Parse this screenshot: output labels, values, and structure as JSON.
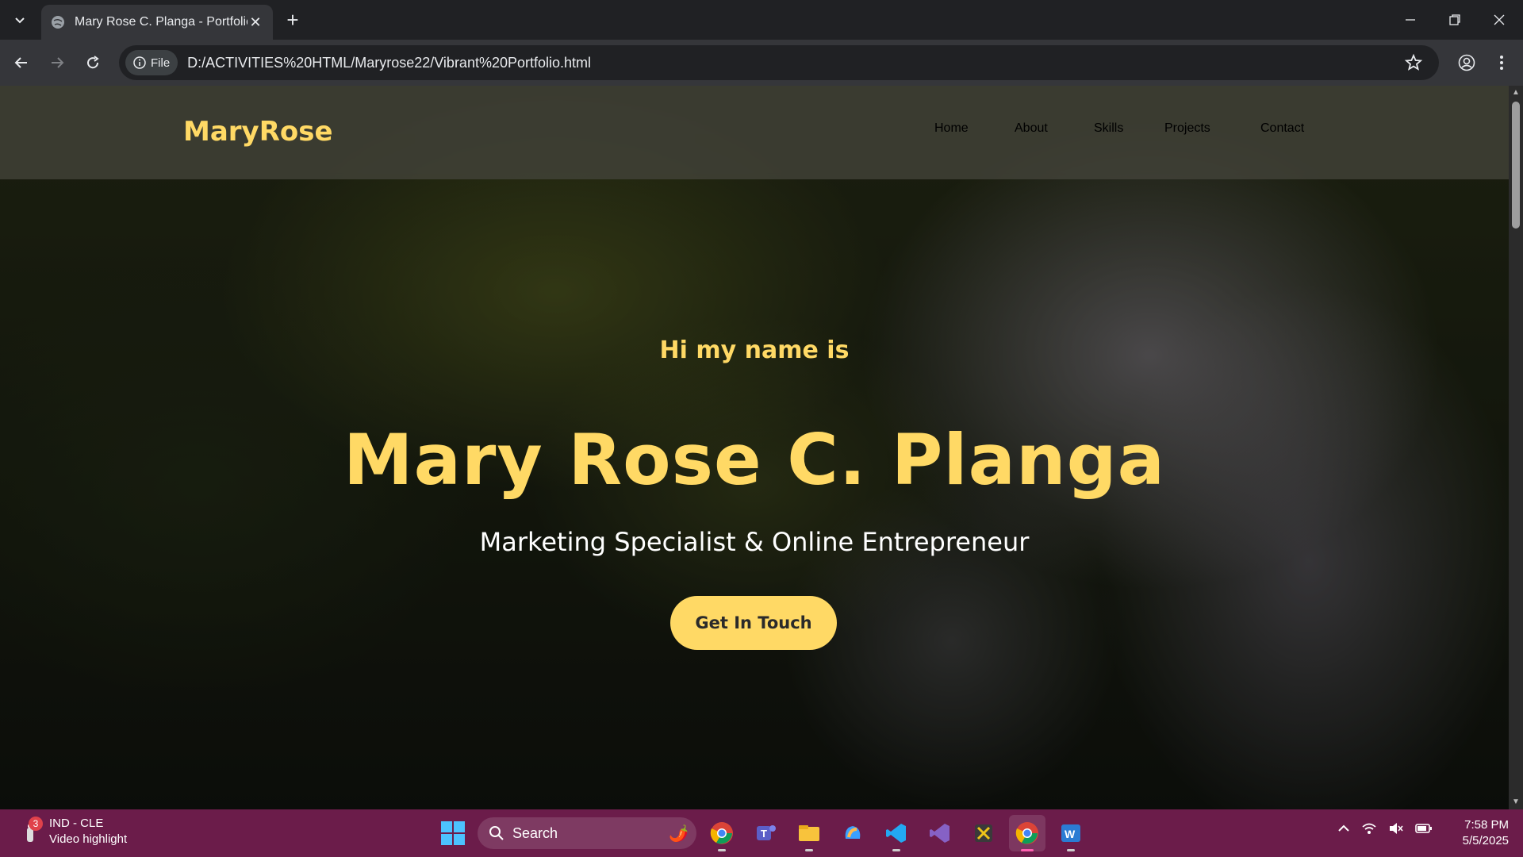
{
  "browser": {
    "tab_title": "Mary Rose C. Planga - Portfolio",
    "url_chip": "File",
    "url": "D:/ACTIVITIES%20HTML/Maryrose22/Vibrant%20Portfolio.html"
  },
  "page": {
    "logo": "MaryRose",
    "nav": [
      "Home",
      "About",
      "Skills",
      "Projects",
      "Contact"
    ],
    "greeting": "Hi my name is",
    "name": "Mary Rose C. Planga",
    "role": "Marketing Specialist & Online Entrepreneur",
    "cta": "Get In Touch",
    "accent_color": "#ffd965"
  },
  "taskbar": {
    "weather_title": "IND - CLE",
    "weather_subtitle": "Video highlight",
    "notification_count": "3",
    "search_placeholder": "Search",
    "time": "7:58 PM",
    "date": "5/5/2025",
    "apps": [
      "chrome-icon",
      "teams-icon",
      "file-explorer-icon",
      "copilot-icon",
      "vscode-icon",
      "visual-studio-icon",
      "snipping-tool-icon",
      "chrome-active-icon",
      "word-icon"
    ]
  }
}
